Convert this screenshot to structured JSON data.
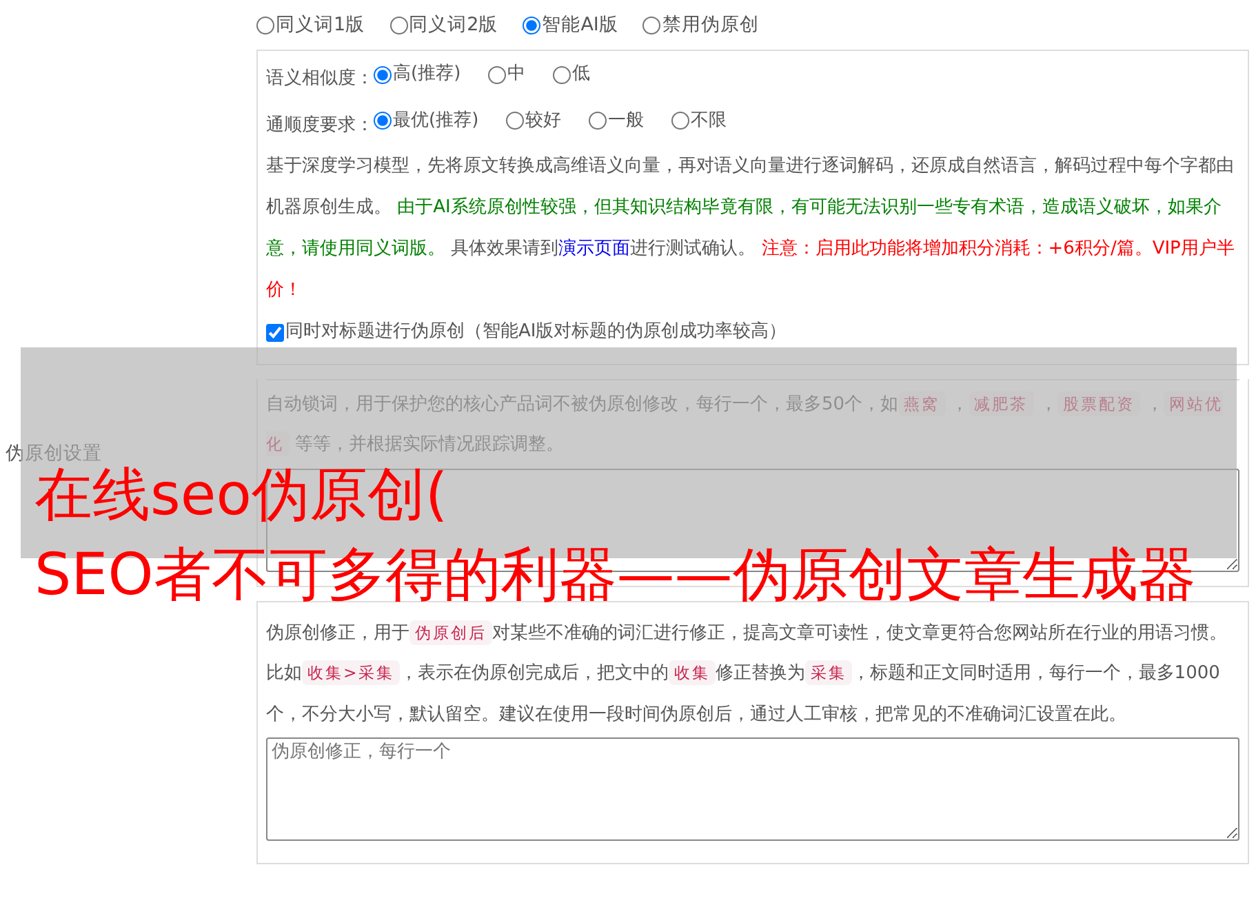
{
  "section_label": "伪原创设置",
  "modes": [
    {
      "label": "同义词1版",
      "selected": false
    },
    {
      "label": "同义词2版",
      "selected": false
    },
    {
      "label": "智能AI版",
      "selected": true
    },
    {
      "label": "禁用伪原创",
      "selected": false
    }
  ],
  "ai_panel": {
    "settings": [
      {
        "label": "语义相似度：",
        "options": [
          {
            "label": "高(推荐)",
            "selected": true
          },
          {
            "label": "中",
            "selected": false
          },
          {
            "label": "低",
            "selected": false
          }
        ]
      },
      {
        "label": "通顺度要求：",
        "options": [
          {
            "label": "最优(推荐)",
            "selected": true
          },
          {
            "label": "较好",
            "selected": false
          },
          {
            "label": "一般",
            "selected": false
          },
          {
            "label": "不限",
            "selected": false
          }
        ]
      }
    ],
    "description": [
      {
        "kind": "text",
        "text": "基于深度学习模型，先将原文转换成高维语义向量，再对语义向量进行逐词解码，还原成自然语言，解码过程中每个字都由机器原创生成。 "
      },
      {
        "kind": "success",
        "text": "由于AI系统原创性较强，但其知识结构毕竟有限，有可能无法识别一些专有术语，造成语义破坏，如果介意，请使用同义词版。"
      },
      {
        "kind": "text",
        "text": " 具体效果请到"
      },
      {
        "kind": "link",
        "text": "演示页面"
      },
      {
        "kind": "text",
        "text": "进行测试确认。 "
      },
      {
        "kind": "warning",
        "text": "注意：启用此功能将增加积分消耗：+6积分/篇。VIP用户半价！"
      }
    ],
    "title_option": {
      "label": "同时对标题进行伪原创（智能AI版对标题的伪原创成功率较高）",
      "checked": true
    }
  },
  "lock_panel": {
    "description": [
      {
        "kind": "text",
        "text": "自动锁词，用于保护您的核心产品词不被伪原创修改，每行一个，最多50个，如"
      },
      {
        "kind": "code",
        "text": "燕窝"
      },
      {
        "kind": "text",
        "text": " ，"
      },
      {
        "kind": "code",
        "text": "减肥茶"
      },
      {
        "kind": "text",
        "text": " ，"
      },
      {
        "kind": "code",
        "text": "股票配资"
      },
      {
        "kind": "text",
        "text": " ，"
      },
      {
        "kind": "code",
        "text": "网站优化"
      },
      {
        "kind": "text",
        "text": " 等等，并根据实际情况跟踪调整。"
      }
    ]
  },
  "correction_panel": {
    "description": [
      {
        "kind": "text",
        "text": "伪原创修正，用于"
      },
      {
        "kind": "code",
        "text": "伪原创后"
      },
      {
        "kind": "text",
        "text": "对某些不准确的词汇进行修正，提高文章可读性，使文章更符合您网站所在行业的用语习惯。比如"
      },
      {
        "kind": "code",
        "text": "收集>采集"
      },
      {
        "kind": "text",
        "text": "，表示在伪原创完成后，把文中的"
      },
      {
        "kind": "code",
        "text": "收集"
      },
      {
        "kind": "text",
        "text": "修正替换为"
      },
      {
        "kind": "code",
        "text": "采集"
      },
      {
        "kind": "text",
        "text": "，标题和正文同时适用，每行一个，最多1000个，不分大小写，默认留空。建议在使用一段时间伪原创后，通过人工审核，把常见的不准确词汇设置在此。"
      }
    ],
    "placeholder": "伪原创修正，每行一个"
  },
  "banner": {
    "lines": [
      "在线seo伪原创(",
      "SEO者不可多得的利器——伪原创文章生成器"
    ]
  }
}
